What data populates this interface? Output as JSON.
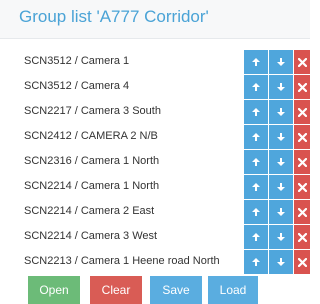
{
  "panel": {
    "title": "Group list 'A777 Corridor'"
  },
  "colors": {
    "title": "#4aa3d6",
    "move_button": "#4fa6dc",
    "delete_button": "#d9534f",
    "open_button": "#6cbb78",
    "clear_button": "#d95c55",
    "save_load_button": "#5aade0"
  },
  "icons": {
    "move_up": "arrow-up-icon",
    "move_down": "arrow-down-icon",
    "remove": "close-icon"
  },
  "cameras": [
    {
      "label": "SCN3512 / Camera 1"
    },
    {
      "label": "SCN3512 / Camera 4"
    },
    {
      "label": "SCN2217 / Camera 3 South"
    },
    {
      "label": "SCN2412 / CAMERA 2 N/B"
    },
    {
      "label": "SCN2316 / Camera 1 North"
    },
    {
      "label": "SCN2214 / Camera 1 North"
    },
    {
      "label": "SCN2214 / Camera 2 East"
    },
    {
      "label": "SCN2214 / Camera 3 West"
    },
    {
      "label": "SCN2213 / Camera 1 Heene road North"
    }
  ],
  "actions": {
    "open": "Open",
    "clear": "Clear",
    "save": "Save",
    "load": "Load"
  }
}
